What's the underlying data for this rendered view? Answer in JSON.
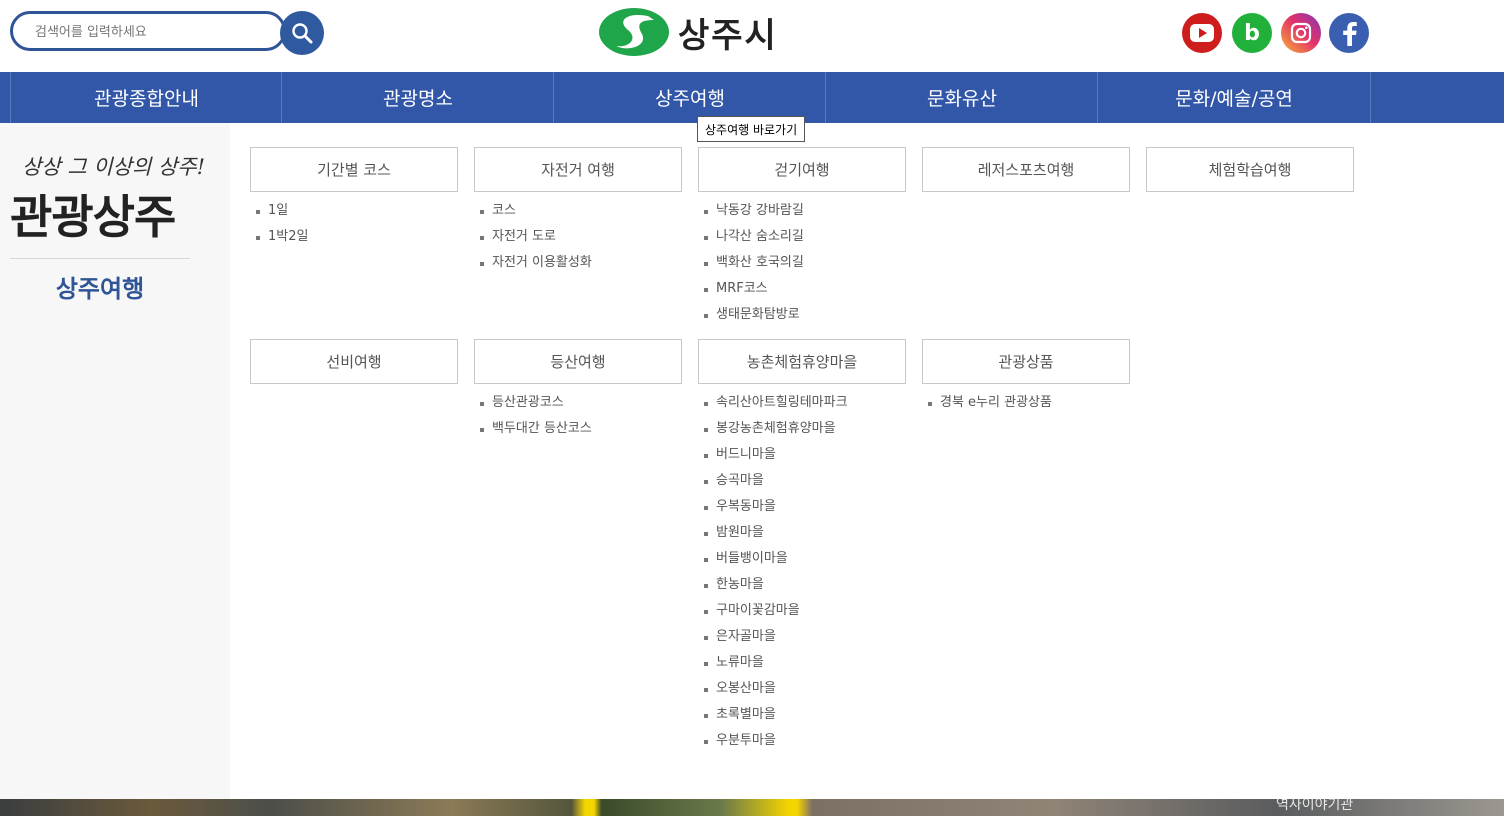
{
  "search": {
    "placeholder": "검색어를 입력하세요"
  },
  "logo": {
    "text": "상주시"
  },
  "social": [
    "youtube-icon",
    "blog-icon",
    "instagram-icon",
    "facebook-icon"
  ],
  "nav": [
    "관광종합안내",
    "관광명소",
    "상주여행",
    "문화유산",
    "문화/예술/공연"
  ],
  "tooltip": "상주여행 바로가기",
  "side": {
    "slogan": "상상 그 이상의 상주!",
    "title": "관광상주",
    "current": "상주여행"
  },
  "menus": [
    {
      "label": "기간별 코스",
      "items": [
        "1일",
        "1박2일"
      ]
    },
    {
      "label": "자전거 여행",
      "items": [
        "코스",
        "자전거 도로",
        "자전거 이용활성화"
      ]
    },
    {
      "label": "걷기여행",
      "items": [
        "낙동강 강바람길",
        "나각산 숨소리길",
        "백화산 호국의길",
        "MRF코스",
        "생태문화탐방로"
      ]
    },
    {
      "label": "레저스포츠여행",
      "items": []
    },
    {
      "label": "체험학습여행",
      "items": []
    },
    {
      "label": "선비여행",
      "items": []
    },
    {
      "label": "등산여행",
      "items": [
        "등산관광코스",
        "백두대간 등산코스"
      ]
    },
    {
      "label": "농촌체험휴양마을",
      "items": [
        "속리산아트힐링테마파크",
        "봉강농촌체험휴양마을",
        "버드니마을",
        "승곡마을",
        "우복동마을",
        "밤원마을",
        "버들뱅이마을",
        "한농마을",
        "구마이꽃감마을",
        "은자골마을",
        "노류마을",
        "오봉산마을",
        "초록별마을",
        "우분투마을"
      ]
    },
    {
      "label": "관광상품",
      "items": [
        "경북 e누리 관광상품"
      ]
    }
  ],
  "bottom_text": "역사이야기관",
  "colors": {
    "nav": "#3257a8",
    "accent": "#2f5597",
    "logo_green": "#1fa54a"
  }
}
